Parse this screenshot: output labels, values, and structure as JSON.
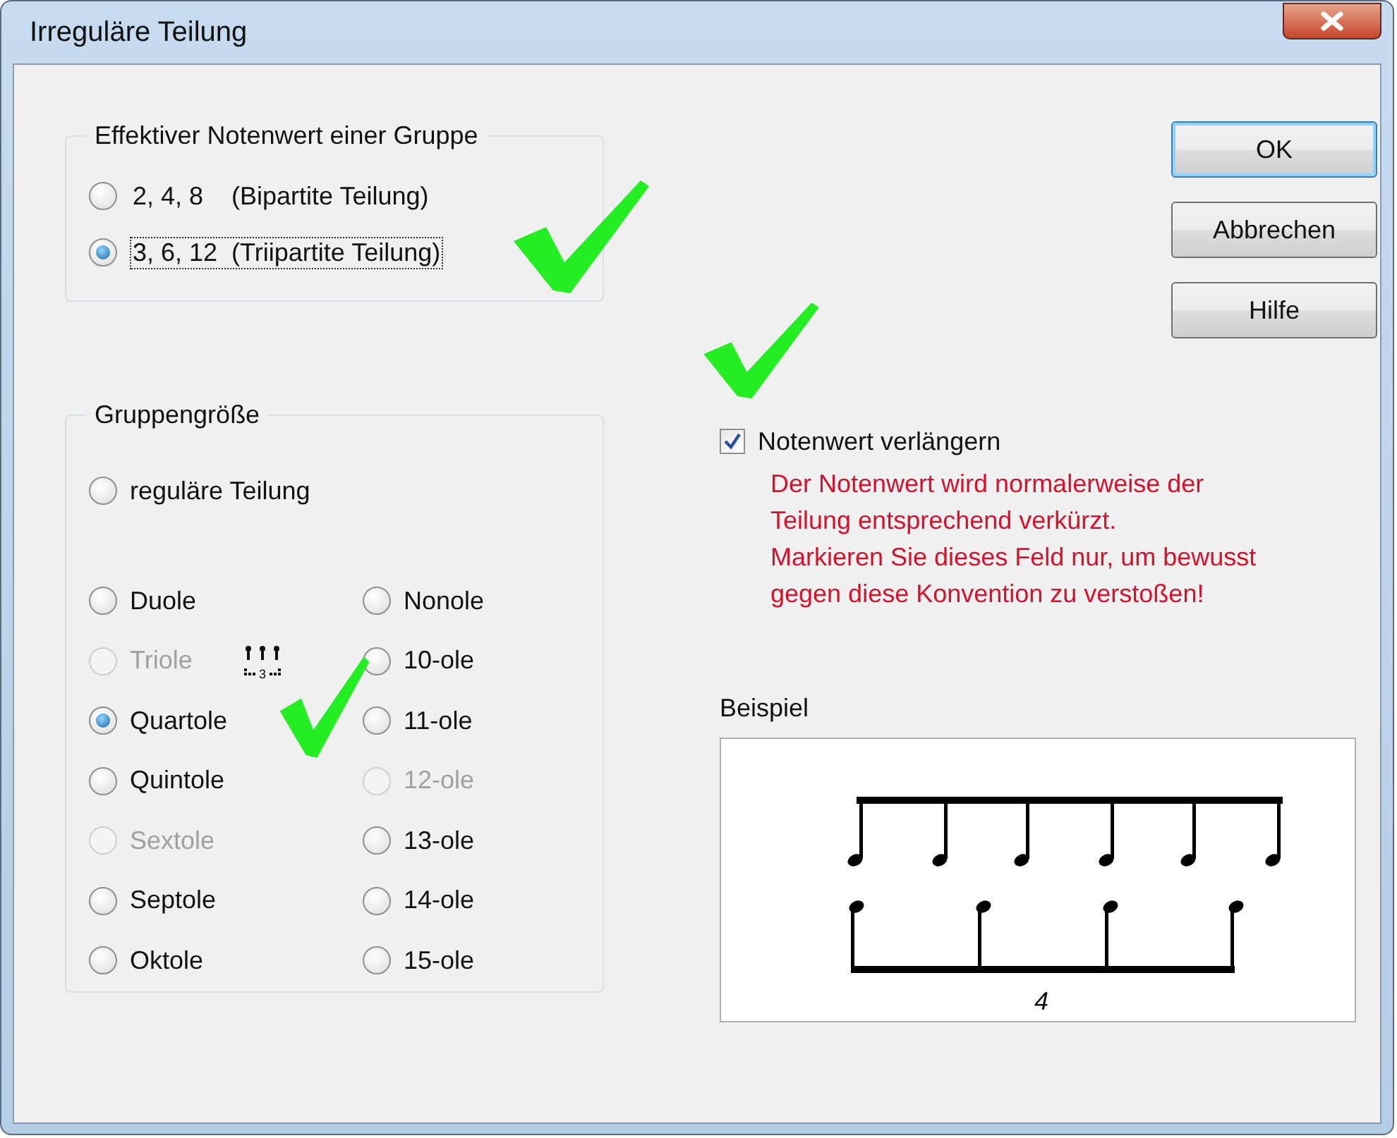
{
  "window": {
    "title": "Irreguläre Teilung"
  },
  "effective_value_group": {
    "title": "Effektiver Notenwert einer Gruppe",
    "options": [
      {
        "label": "2, 4, 8    (Bipartite Teilung)",
        "selected": false,
        "focused": false
      },
      {
        "label": "3, 6, 12  (Triipartite Teilung)",
        "selected": true,
        "focused": true
      }
    ]
  },
  "group_size": {
    "title": "Gruppengröße",
    "regular": {
      "label": "reguläre Teilung",
      "selected": false
    },
    "options": [
      {
        "label": "Duole",
        "selected": false,
        "disabled": false,
        "kind": "plain"
      },
      {
        "label": "Triole",
        "selected": false,
        "disabled": true,
        "kind": "tuplet",
        "tuplet_number": "3"
      },
      {
        "label": "Quartole",
        "selected": true,
        "disabled": false,
        "kind": "plain"
      },
      {
        "label": "Quintole",
        "selected": false,
        "disabled": false,
        "kind": "plain"
      },
      {
        "label": "Sextole",
        "selected": false,
        "disabled": true,
        "kind": "plain"
      },
      {
        "label": "Septole",
        "selected": false,
        "disabled": false,
        "kind": "plain"
      },
      {
        "label": "Oktole",
        "selected": false,
        "disabled": false,
        "kind": "plain"
      },
      {
        "label": "Nonole",
        "selected": false,
        "disabled": false,
        "kind": "plain"
      },
      {
        "label": "10-ole",
        "selected": false,
        "disabled": false,
        "kind": "plain"
      },
      {
        "label": "11-ole",
        "selected": false,
        "disabled": false,
        "kind": "plain"
      },
      {
        "label": "12-ole",
        "selected": false,
        "disabled": true,
        "kind": "plain"
      },
      {
        "label": "13-ole",
        "selected": false,
        "disabled": false,
        "kind": "plain"
      },
      {
        "label": "14-ole",
        "selected": false,
        "disabled": false,
        "kind": "plain"
      },
      {
        "label": "15-ole",
        "selected": false,
        "disabled": false,
        "kind": "plain"
      }
    ]
  },
  "buttons": [
    {
      "label": "OK",
      "default": true
    },
    {
      "label": "Abbrechen",
      "default": false
    },
    {
      "label": "Hilfe",
      "default": false
    }
  ],
  "extend_checkbox": {
    "label": "Notenwert verlängern",
    "checked": true
  },
  "note": "Der Notenwert wird normalerweise der\nTeilung entsprechend verkürzt.\nMarkieren Sie dieses Feld nur, um bewusst\ngegen diese Konvention zu verstoßen!",
  "example": {
    "title": "Beispiel",
    "tuplet_number": "4"
  }
}
